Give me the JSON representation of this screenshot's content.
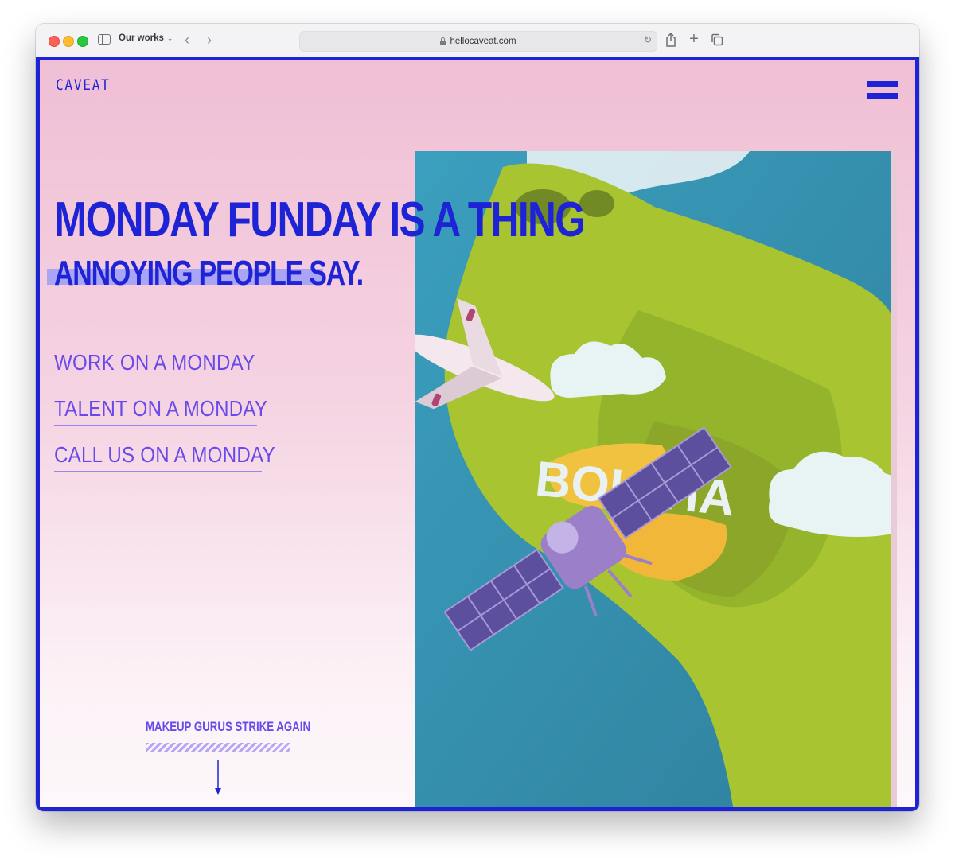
{
  "browser": {
    "tab_title": "Our works",
    "url": "hellocaveat.com"
  },
  "page": {
    "logo": "CAVEAT",
    "headline": "MONDAY FUNDAY IS A THING",
    "subheadline": "ANNOYING PEOPLE SAY.",
    "nav_links": [
      {
        "label": "WORK ON A MONDAY"
      },
      {
        "label": "TALENT ON A MONDAY"
      },
      {
        "label": "CALL US ON A MONDAY"
      }
    ],
    "featured_project": "MAKEUP GURUS STRIKE AGAIN",
    "hero_map_label": "BOLIVIA"
  },
  "colors": {
    "brand_blue": "#1f23d6",
    "link_purple": "#6a49ea",
    "background_pink": "#f0bfd5",
    "highlight_lavender": "#a9a4f4"
  },
  "icons": [
    "sidebar-icon",
    "chevron-down-icon",
    "back-icon",
    "forward-icon",
    "lock-icon",
    "reload-icon",
    "share-icon",
    "new-tab-icon",
    "tabs-overview-icon",
    "hamburger-menu-icon",
    "arrow-down-icon"
  ]
}
